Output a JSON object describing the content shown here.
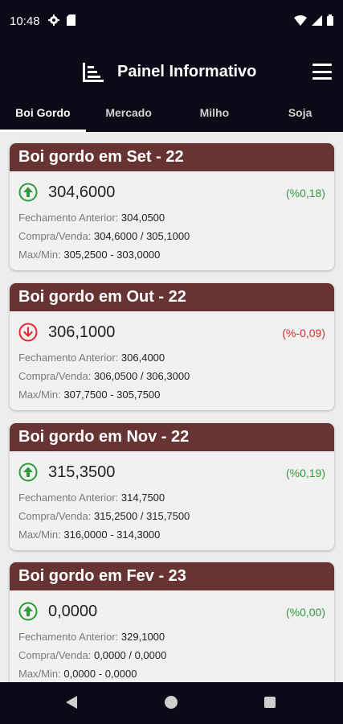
{
  "status_bar": {
    "time": "10:48",
    "left_icons": [
      "gear-icon",
      "sd-card-icon"
    ],
    "right_icons": [
      "wifi-icon",
      "signal-icon",
      "battery-icon"
    ]
  },
  "header": {
    "title": "Painel Informativo",
    "logo_icon": "list-chart-icon",
    "menu_icon": "hamburger-menu-icon"
  },
  "tabs": [
    {
      "label": "Boi Gordo",
      "active": true
    },
    {
      "label": "Mercado",
      "active": false
    },
    {
      "label": "Milho",
      "active": false
    },
    {
      "label": "Soja",
      "active": false
    }
  ],
  "labels": {
    "fechamento": "Fechamento Anterior:",
    "compra_venda": "Compra/Venda:",
    "max_min": "Max/Min:"
  },
  "cards": [
    {
      "title": "Boi gordo em Set - 22",
      "price": "304,6000",
      "trend": "up",
      "change": "(%0,18)",
      "fechamento": "304,0500",
      "compra": "304,6000",
      "venda": "305,1000",
      "max": "305,2500",
      "min": "303,0000"
    },
    {
      "title": "Boi gordo em Out - 22",
      "price": "306,1000",
      "trend": "down",
      "change": "(%-0,09)",
      "fechamento": "306,4000",
      "compra": "306,0500",
      "venda": "306,3000",
      "max": "307,7500",
      "min": "305,7500"
    },
    {
      "title": "Boi gordo em Nov - 22",
      "price": "315,3500",
      "trend": "up",
      "change": "(%0,19)",
      "fechamento": "314,7500",
      "compra": "315,2500",
      "venda": "315,7500",
      "max": "316,0000",
      "min": "314,3000"
    },
    {
      "title": "Boi gordo em Fev - 23",
      "price": "0,0000",
      "trend": "up",
      "change": "(%0,00)",
      "fechamento": "329,1000",
      "compra": "0,0000",
      "venda": "0,0000",
      "max": "0,0000",
      "min": "0,0000"
    }
  ],
  "colors": {
    "app_bar": "#0c0a17",
    "card_header": "#673433",
    "up": "#2e9b3a",
    "down": "#e0292b"
  },
  "nav_bar": {
    "icons": [
      "back-icon",
      "home-icon",
      "recents-icon"
    ]
  }
}
